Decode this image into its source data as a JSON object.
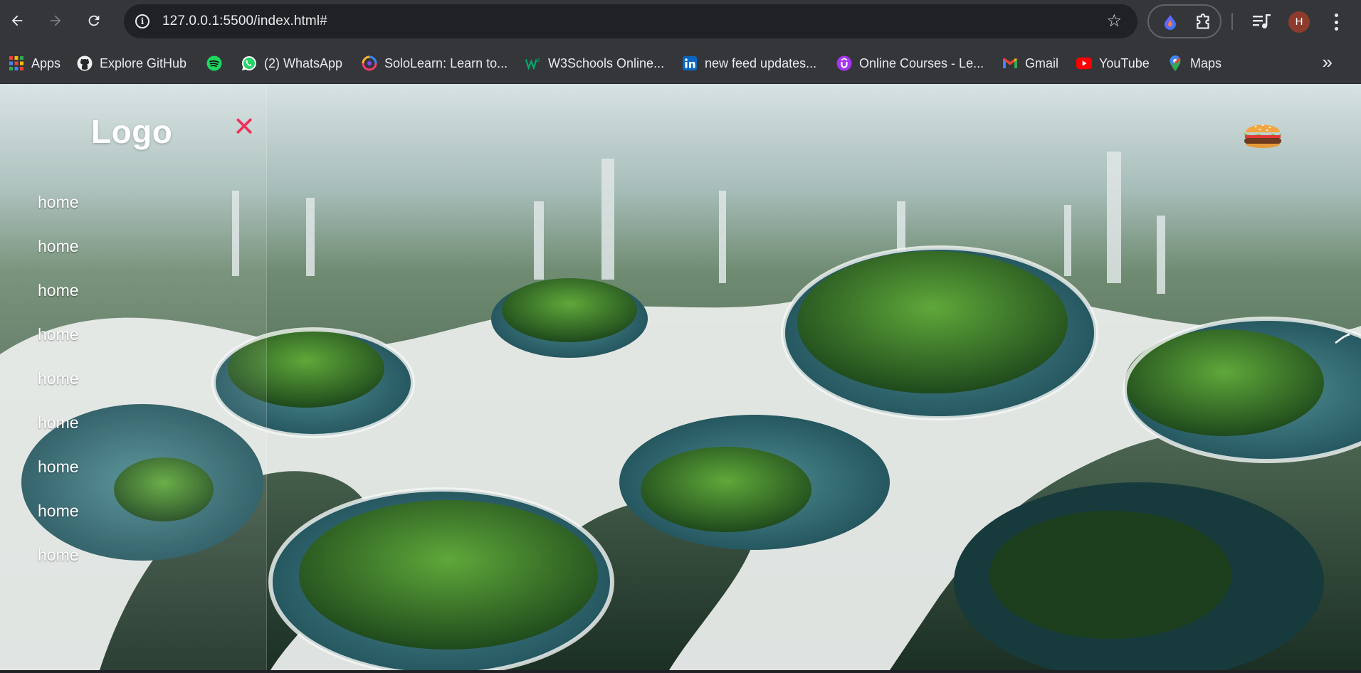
{
  "browser": {
    "url": "127.0.0.1:5500/index.html#",
    "avatar_letter": "H",
    "bookmarks_more": "»",
    "bookmarks": [
      {
        "label": "Apps",
        "icon": "apps-grid-icon"
      },
      {
        "label": "Explore GitHub",
        "icon": "github-icon"
      },
      {
        "label": "",
        "icon": "spotify-icon"
      },
      {
        "label": "(2) WhatsApp",
        "icon": "whatsapp-icon"
      },
      {
        "label": "SoloLearn: Learn to...",
        "icon": "sololearn-icon"
      },
      {
        "label": "W3Schools Online...",
        "icon": "w3schools-icon"
      },
      {
        "label": "new feed updates...",
        "icon": "linkedin-icon"
      },
      {
        "label": "Online Courses - Le...",
        "icon": "udemy-icon"
      },
      {
        "label": "Gmail",
        "icon": "gmail-icon"
      },
      {
        "label": "YouTube",
        "icon": "youtube-icon"
      },
      {
        "label": "Maps",
        "icon": "maps-icon"
      }
    ]
  },
  "page": {
    "logo": "Logo",
    "close_symbol": "✕",
    "menu": [
      "home",
      "home",
      "home",
      "home",
      "home",
      "home",
      "home",
      "home",
      "home"
    ],
    "hamburger_icon": "burger-emoji-icon"
  },
  "colors": {
    "close_accent": "#ef2f5a",
    "chrome_bg": "#35363a",
    "omnibox_bg": "#202124"
  }
}
